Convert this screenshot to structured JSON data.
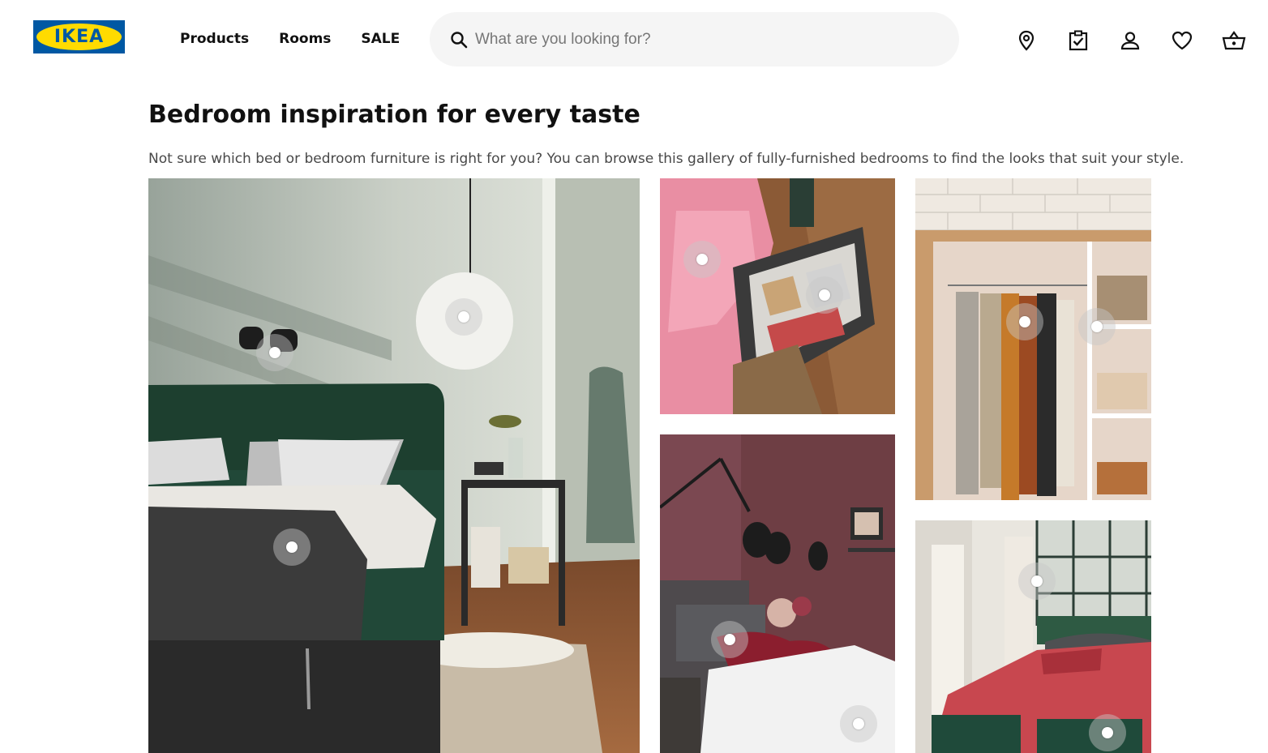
{
  "header": {
    "logo_text": "IKEA",
    "nav": [
      {
        "label": "Products"
      },
      {
        "label": "Rooms"
      },
      {
        "label": "SALE"
      }
    ],
    "search": {
      "placeholder": "What are you looking for?"
    },
    "icons": [
      "location-pin-icon",
      "checklist-icon",
      "user-icon",
      "heart-icon",
      "cart-icon"
    ]
  },
  "main": {
    "title": "Bedroom inspiration for every taste",
    "description": "Not sure which bed or bedroom furniture is right for you? You can browse this gallery of fully-furnished bedrooms to find the looks that suit your style."
  },
  "colors": {
    "brand_blue": "#0058a3",
    "brand_yellow": "#ffdb00",
    "search_bg": "#f5f5f5"
  }
}
